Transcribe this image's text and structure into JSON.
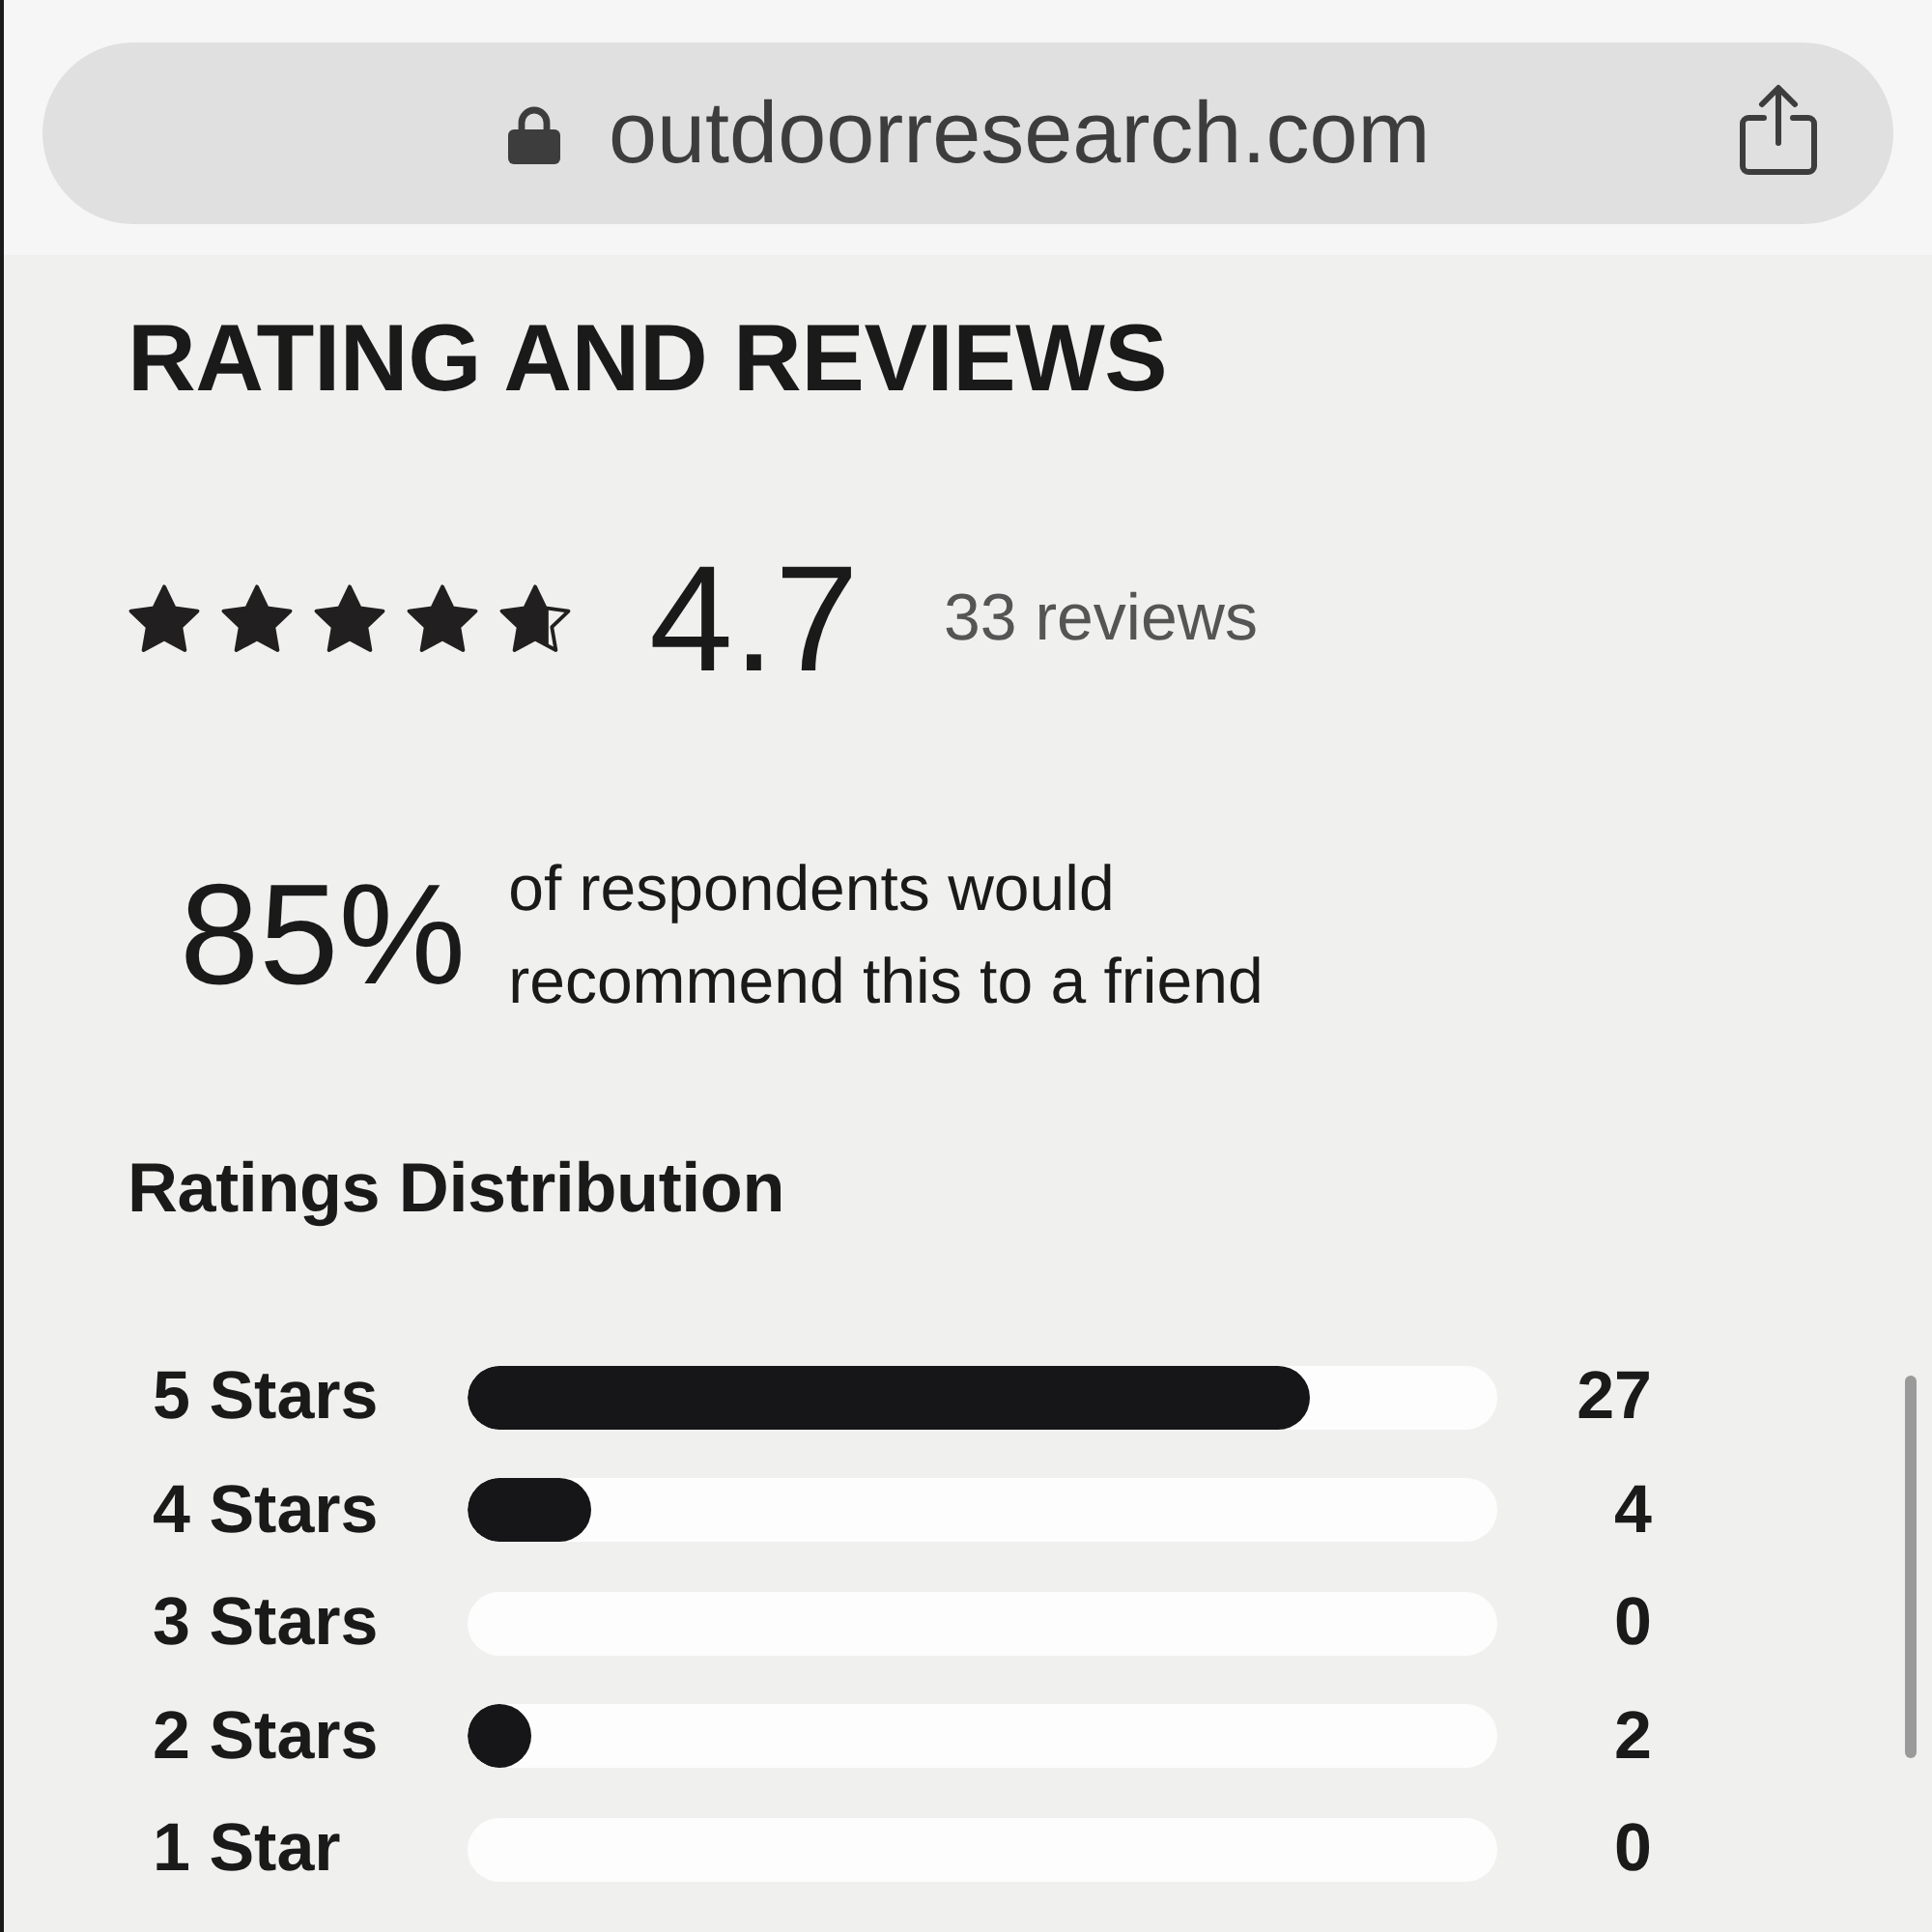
{
  "browser_bar": {
    "url": "outdoorresearch.com"
  },
  "title": "RATING AND REVIEWS",
  "rating": {
    "stars": 4.7,
    "score": "4.7",
    "reviews": "33 reviews"
  },
  "recommend": {
    "percent": "85%",
    "text": "of respondents would recommend this to a friend"
  },
  "distribution": {
    "title": "Ratings Distribution",
    "rows": [
      {
        "label": "5 Stars",
        "level": 0.818,
        "count": "27"
      },
      {
        "label": "4 Stars",
        "level": 0.121,
        "count": "4"
      },
      {
        "label": "3 Stars",
        "count": "0"
      },
      {
        "label": "2 Stars",
        "level": 0.061,
        "count": "2"
      },
      {
        "label": "1 Star",
        "count": "0"
      }
    ]
  }
}
